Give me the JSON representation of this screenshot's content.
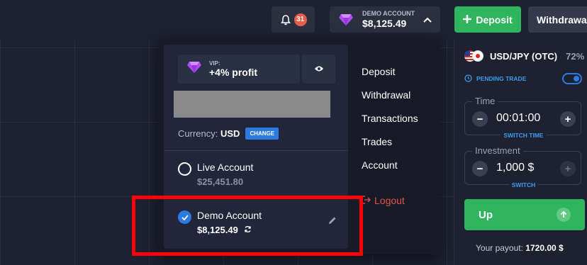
{
  "topbar": {
    "notification_count": "31",
    "account_label": "DEMO ACCOUNT",
    "account_balance": "$8,125.49",
    "deposit_label": "Deposit",
    "withdrawal_label": "Withdrawal"
  },
  "dropdown": {
    "vip_label": "VIP:",
    "vip_profit": "+4% profit",
    "currency_label": "Currency:",
    "currency_value": "USD",
    "change_label": "CHANGE",
    "accounts": [
      {
        "name": "Live Account",
        "balance": "$25,451.80",
        "selected": false
      },
      {
        "name": "Demo Account",
        "balance": "$8,125.49",
        "selected": true
      }
    ],
    "menu": [
      "Deposit",
      "Withdrawal",
      "Transactions",
      "Trades",
      "Account"
    ],
    "logout_label": "Logout"
  },
  "trade_panel": {
    "pair": "USD/JPY (OTC)",
    "payout_pct": "72%",
    "pending_label": "PENDING TRADE",
    "time_label": "Time",
    "time_value": "00:01:00",
    "switch_time_label": "SWITCH TIME",
    "investment_label": "Investment",
    "investment_value": "1,000 $",
    "switch_label": "SWITCH",
    "up_label": "Up",
    "your_payout_label": "Your payout:",
    "your_payout_value": "1720.00 $"
  },
  "colors": {
    "background": "#1d2130",
    "accent_green": "#2fb55d",
    "accent_blue": "#2d7be0",
    "logout_red": "#e0544a",
    "highlight_red": "#ff0000"
  }
}
